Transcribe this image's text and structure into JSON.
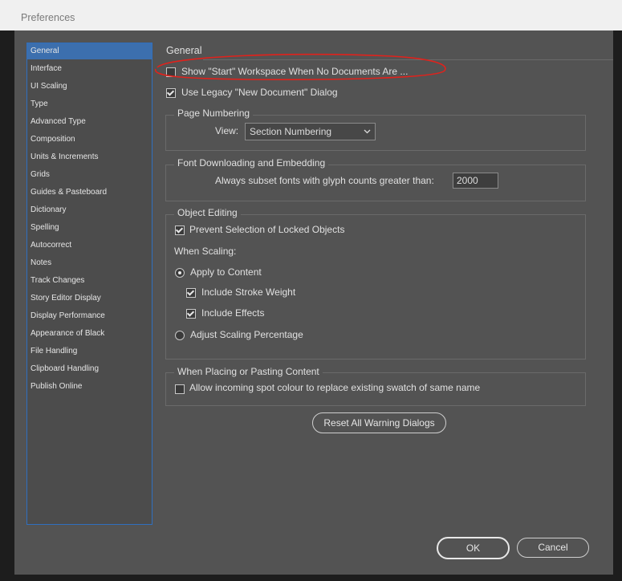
{
  "window": {
    "title": "Preferences"
  },
  "sidebar": {
    "items": [
      {
        "label": "General"
      },
      {
        "label": "Interface"
      },
      {
        "label": "UI Scaling"
      },
      {
        "label": "Type"
      },
      {
        "label": "Advanced Type"
      },
      {
        "label": "Composition"
      },
      {
        "label": "Units & Increments"
      },
      {
        "label": "Grids"
      },
      {
        "label": "Guides & Pasteboard"
      },
      {
        "label": "Dictionary"
      },
      {
        "label": "Spelling"
      },
      {
        "label": "Autocorrect"
      },
      {
        "label": "Notes"
      },
      {
        "label": "Track Changes"
      },
      {
        "label": "Story Editor Display"
      },
      {
        "label": "Display Performance"
      },
      {
        "label": "Appearance of Black"
      },
      {
        "label": "File Handling"
      },
      {
        "label": "Clipboard Handling"
      },
      {
        "label": "Publish Online"
      }
    ],
    "selected": "General"
  },
  "general": {
    "heading": "General",
    "show_start_workspace": {
      "label": "Show \"Start\" Workspace When No Documents Are ...",
      "checked": false
    },
    "use_legacy_new_doc": {
      "label": "Use Legacy \"New Document\" Dialog",
      "checked": true
    }
  },
  "page_numbering": {
    "title": "Page Numbering",
    "view_label": "View:",
    "view_value": "Section Numbering"
  },
  "font_downloading": {
    "title": "Font Downloading and Embedding",
    "subset_label": "Always subset fonts with glyph counts greater than:",
    "subset_value": "2000"
  },
  "object_editing": {
    "title": "Object Editing",
    "prevent_selection": {
      "label": "Prevent Selection of Locked Objects",
      "checked": true
    },
    "when_scaling": "When Scaling:",
    "apply_to_content": {
      "label": "Apply to Content",
      "selected": true
    },
    "include_stroke": {
      "label": "Include Stroke Weight",
      "checked": true
    },
    "include_effects": {
      "label": "Include Effects",
      "checked": true
    },
    "adjust_scaling": {
      "label": "Adjust Scaling Percentage",
      "selected": false
    }
  },
  "placing": {
    "title": "When Placing or Pasting Content",
    "allow_spot": {
      "label": "Allow incoming spot colour to replace existing swatch of same name",
      "checked": false
    }
  },
  "buttons": {
    "reset_warnings": "Reset All Warning Dialogs",
    "ok": "OK",
    "cancel": "Cancel"
  },
  "colors": {
    "accent": "#3c6fae",
    "annotation": "#e0221c",
    "panel": "#535353"
  }
}
